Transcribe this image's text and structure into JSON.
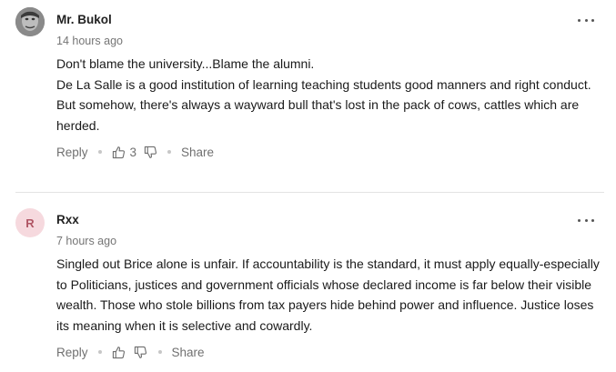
{
  "comments": [
    {
      "author": "Mr. Bukol",
      "time": "14 hours ago",
      "paragraphs": [
        "Don't blame the university...Blame the alumni.",
        "De La Salle is a good institution of learning teaching students good manners and right conduct.",
        "But somehow, there's always a wayward bull that's lost in the pack of cows, cattles which are herded."
      ],
      "reply_label": "Reply",
      "like_count": "3",
      "share_label": "Share"
    },
    {
      "author": "Rxx",
      "avatar_letter": "R",
      "time": "7 hours ago",
      "paragraphs": [
        "Singled out Brice alone is unfair. If accountability is the standard, it must apply equally-especially to Politicians, justices and government officials whose declared income is far below their visible wealth. Those who stole billions from tax payers hide behind power and influence. Justice loses its meaning when it is selective and cowardly."
      ],
      "reply_label": "Reply",
      "share_label": "Share"
    }
  ],
  "icons": {
    "like": "thumbs-up-icon",
    "dislike": "thumbs-down-icon",
    "more": "more-options-icon"
  },
  "colors": {
    "avatar_letter_bg": "#f6d9de",
    "avatar_letter_fg": "#b05564",
    "meta_gray": "#757575"
  }
}
